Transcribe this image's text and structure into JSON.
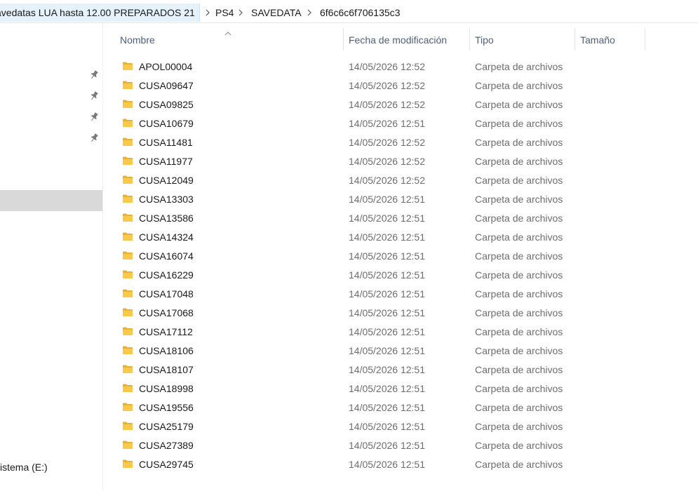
{
  "address": {
    "crumbs": [
      "avedatas LUA hasta 12.00 PREPARADOS 21",
      "PS4",
      "SAVEDATA",
      "6f6c6c6f706135c3"
    ],
    "separator": "›"
  },
  "navigation": {
    "drive_label": "istema (E:)"
  },
  "columns": {
    "name": "Nombre",
    "date": "Fecha de modificación",
    "type": "Tipo",
    "size": "Tamaño"
  },
  "files": [
    {
      "name": "APOL00004",
      "date": "14/05/2026 12:52",
      "type": "Carpeta de archivos",
      "size": ""
    },
    {
      "name": "CUSA09647",
      "date": "14/05/2026 12:52",
      "type": "Carpeta de archivos",
      "size": ""
    },
    {
      "name": "CUSA09825",
      "date": "14/05/2026 12:52",
      "type": "Carpeta de archivos",
      "size": ""
    },
    {
      "name": "CUSA10679",
      "date": "14/05/2026 12:51",
      "type": "Carpeta de archivos",
      "size": ""
    },
    {
      "name": "CUSA11481",
      "date": "14/05/2026 12:52",
      "type": "Carpeta de archivos",
      "size": ""
    },
    {
      "name": "CUSA11977",
      "date": "14/05/2026 12:52",
      "type": "Carpeta de archivos",
      "size": ""
    },
    {
      "name": "CUSA12049",
      "date": "14/05/2026 12:52",
      "type": "Carpeta de archivos",
      "size": ""
    },
    {
      "name": "CUSA13303",
      "date": "14/05/2026 12:51",
      "type": "Carpeta de archivos",
      "size": ""
    },
    {
      "name": "CUSA13586",
      "date": "14/05/2026 12:51",
      "type": "Carpeta de archivos",
      "size": ""
    },
    {
      "name": "CUSA14324",
      "date": "14/05/2026 12:51",
      "type": "Carpeta de archivos",
      "size": ""
    },
    {
      "name": "CUSA16074",
      "date": "14/05/2026 12:51",
      "type": "Carpeta de archivos",
      "size": ""
    },
    {
      "name": "CUSA16229",
      "date": "14/05/2026 12:51",
      "type": "Carpeta de archivos",
      "size": ""
    },
    {
      "name": "CUSA17048",
      "date": "14/05/2026 12:51",
      "type": "Carpeta de archivos",
      "size": ""
    },
    {
      "name": "CUSA17068",
      "date": "14/05/2026 12:51",
      "type": "Carpeta de archivos",
      "size": ""
    },
    {
      "name": "CUSA17112",
      "date": "14/05/2026 12:51",
      "type": "Carpeta de archivos",
      "size": ""
    },
    {
      "name": "CUSA18106",
      "date": "14/05/2026 12:51",
      "type": "Carpeta de archivos",
      "size": ""
    },
    {
      "name": "CUSA18107",
      "date": "14/05/2026 12:51",
      "type": "Carpeta de archivos",
      "size": ""
    },
    {
      "name": "CUSA18998",
      "date": "14/05/2026 12:51",
      "type": "Carpeta de archivos",
      "size": ""
    },
    {
      "name": "CUSA19556",
      "date": "14/05/2026 12:51",
      "type": "Carpeta de archivos",
      "size": ""
    },
    {
      "name": "CUSA25179",
      "date": "14/05/2026 12:51",
      "type": "Carpeta de archivos",
      "size": ""
    },
    {
      "name": "CUSA27389",
      "date": "14/05/2026 12:51",
      "type": "Carpeta de archivos",
      "size": ""
    },
    {
      "name": "CUSA29745",
      "date": "14/05/2026 12:51",
      "type": "Carpeta de archivos",
      "size": ""
    }
  ],
  "colors": {
    "accent_selection": "#e5f1fb",
    "header_text": "#4c607a",
    "folder_yellow": "#f8c94a",
    "nav_selected": "#d9d9d9"
  },
  "icons": {
    "folder": "folder-icon",
    "pin": "pin-icon",
    "sort": "sort-ascending-icon",
    "separator": "chevron-right-icon"
  }
}
